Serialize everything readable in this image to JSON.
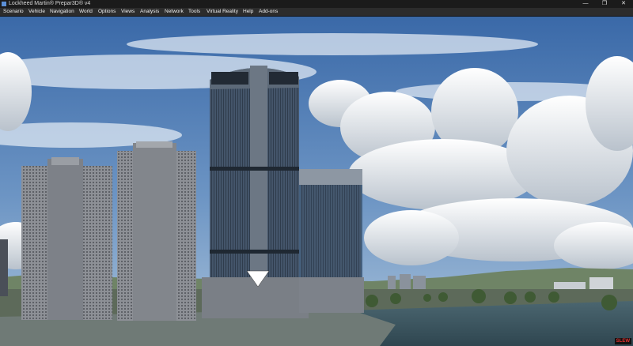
{
  "window": {
    "title": "Lockheed Martin® Prepar3D® v4",
    "controls": [
      "—",
      "❐",
      "✕"
    ]
  },
  "menu": {
    "items": [
      "Scenario",
      "Vehicle",
      "Navigation",
      "World",
      "Options",
      "Views",
      "Analysis",
      "Network",
      "Tools",
      "Virtual Reality",
      "Help",
      "Add-ons"
    ]
  },
  "status_badge": "SLEW",
  "colors": {
    "sky_top": "#3c6aa8",
    "sky_bottom": "#9fbbd6",
    "water": "#3d5560",
    "badge_text": "#e03030"
  }
}
